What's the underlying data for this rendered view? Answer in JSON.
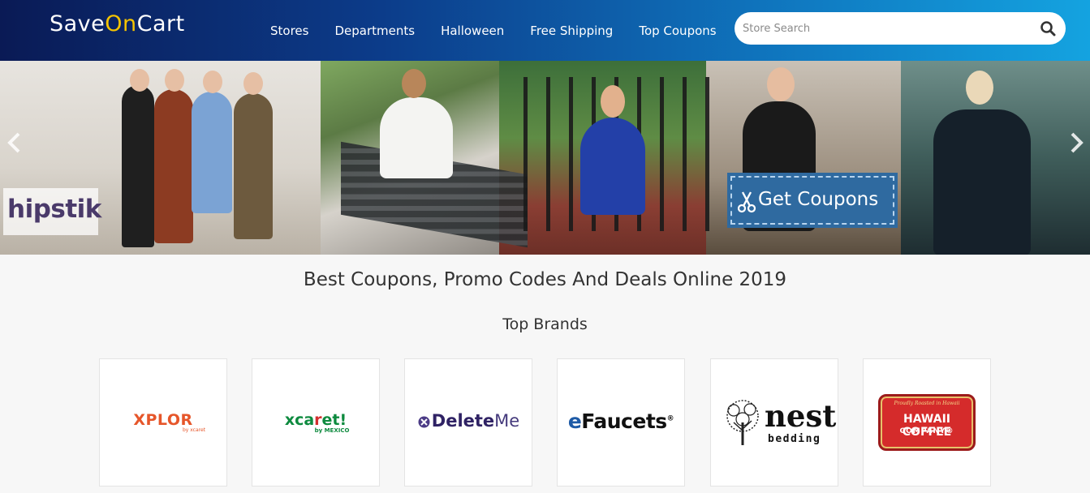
{
  "header": {
    "logo_pre": "Save",
    "logo_hl": "On",
    "logo_post": "Cart",
    "nav": [
      "Stores",
      "Departments",
      "Halloween",
      "Free Shipping",
      "Top Coupons"
    ],
    "search_placeholder": "Store Search"
  },
  "banner": {
    "brand_logo": "hipstik",
    "cta_label": "Get Coupons",
    "icons": [
      "chevron-left-icon",
      "chevron-right-icon",
      "scissors-icon"
    ]
  },
  "main": {
    "headline": "Best Coupons, Promo Codes And Deals Online 2019",
    "section_title": "Top Brands",
    "brands": [
      {
        "name": "XPLOR",
        "sub": "by xcaret"
      },
      {
        "name": "xcaret!",
        "sub": "by MEXICO"
      },
      {
        "name": "DeleteMe"
      },
      {
        "name": "eFaucets"
      },
      {
        "name": "nest",
        "sub": "bedding"
      },
      {
        "name": "HAWAII COFFEE",
        "sub": "COMPANY®",
        "tagline": "Proudly Roasted in Hawaii"
      }
    ]
  },
  "colors": {
    "header_start": "#0a1a55",
    "header_end": "#14a3e0",
    "logo_highlight": "#f5c400",
    "cta_bg": "#2f6aa0"
  }
}
